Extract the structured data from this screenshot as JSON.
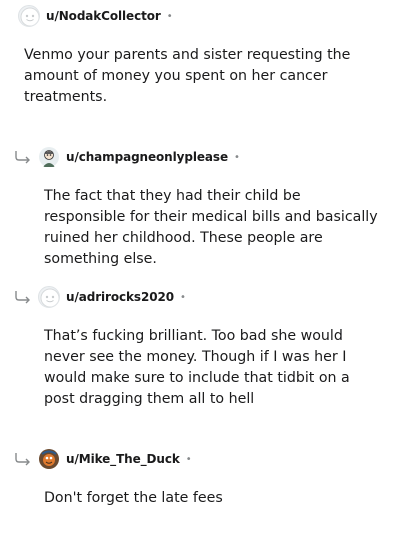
{
  "comments": [
    {
      "username": "u/NodakCollector",
      "text": "Venmo your parents and sister requesting the amount of money you spent on her cancer treatments.",
      "avatar_icon": "default-avatar-icon",
      "is_reply": false
    },
    {
      "username": "u/champagneonlyplease",
      "text": "The fact that they had their child be responsible for their medical bills and basically ruined her childhood. These people are something else.",
      "avatar_icon": "custom-avatar-icon",
      "is_reply": true
    },
    {
      "username": "u/adrirocks2020",
      "text": "That’s fucking brilliant. Too bad she would never see the money. Though if I was her I would make sure to include that tidbit on a post dragging them all to hell",
      "avatar_icon": "default-avatar-icon",
      "is_reply": true
    },
    {
      "username": "u/Mike_The_Duck",
      "text": "Don't forget the late fees",
      "avatar_icon": "custom-avatar-icon",
      "is_reply": true
    }
  ],
  "separator": "•",
  "colors": {
    "text": "#1a1a1b",
    "meta": "#878a8c",
    "reply_arrow": "#878a8c"
  }
}
